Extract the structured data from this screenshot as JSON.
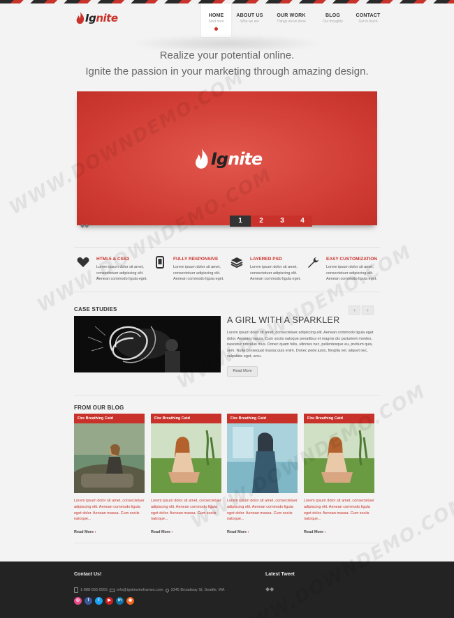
{
  "brand": {
    "logo_prefix": "Ig",
    "logo_suffix": "nite",
    "accent_color": "#c9322a",
    "dark_color": "#232323"
  },
  "nav": [
    {
      "label": "HOME",
      "sub": "Start here",
      "active": true
    },
    {
      "label": "ABOUT US",
      "sub": "Who we are"
    },
    {
      "label": "OUR WORK",
      "sub": "Things we've done"
    },
    {
      "label": "BLOG",
      "sub": "Our thoughts"
    },
    {
      "label": "CONTACT",
      "sub": "Get in touch"
    }
  ],
  "hero": {
    "tagline_1": "Realize your potential online.",
    "tagline_2": "Ignite the passion in your marketing through amazing design."
  },
  "slider": {
    "logo_prefix": "Ig",
    "logo_suffix": "nite",
    "pages": [
      "1",
      "2",
      "3",
      "4"
    ],
    "active_page": 1,
    "mini_nav_icon": "arrows-icon"
  },
  "features": [
    {
      "icon": "heart-icon",
      "title": "HTML5 & CSS3",
      "desc": "Lorem ipsum dolor sit amet, consectetuer adipiscing elit. Aenean commodo ligula eget."
    },
    {
      "icon": "mobile-icon",
      "title": "FULLY RESPONSIVE",
      "desc": "Lorem ipsum dolor sit amet, consectetuer adipiscing elit. Aenean commodo ligula eget."
    },
    {
      "icon": "layers-icon",
      "title": "LAYERED PSD",
      "desc": "Lorem ipsum dolor sit amet, consectetuer adipiscing elit. Aenean commodo ligula eget."
    },
    {
      "icon": "wrench-icon",
      "title": "EASY CUSTOMIZATION",
      "desc": "Lorem ipsum dolor sit amet, consectetuer adipiscing elit. Aenean commodo ligula eget."
    }
  ],
  "case_studies": {
    "section_title": "CASE STUDIES",
    "prev_icon": "‹",
    "next_icon": "›",
    "heading": "A GIRL WITH A SPARKLER",
    "text": "Lorem ipsum dolor sit amet, consectetuer adipiscing elit. Aenean commodo ligula eget dolor. Aenean massa. Cum sociis natoque penatibus et magnis dis parturient montes, nascetur ridiculus mus. Donec quam felis, ultricies nec, pellentesque eu, pretium quis, sem. Nulla consequat massa quis enim. Donec pede justo, fringilla vel, aliquet nec, vulputate eget, arcu.",
    "button": "Read More"
  },
  "blog": {
    "section_title": "FROM OUR BLOG",
    "posts": [
      {
        "header": "Fire Breathing Catd",
        "excerpt": "Lorem ipsum dolor sit amet, consectetuer adipiscing elit. Aenean commodo ligula eget dolor. Aenean massa. Cum sociis natoque...",
        "more": "Read More"
      },
      {
        "header": "Fire Breathing Catd",
        "excerpt": "Lorem ipsum dolor sit amet, consectetuer adipiscing elit. Aenean commodo ligula eget dolor. Aenean massa. Cum sociis natoque...",
        "more": "Read More"
      },
      {
        "header": "Fire Breathing Catd",
        "excerpt": "Lorem ipsum dolor sit amet, consectetuer adipiscing elit. Aenean commodo ligula eget dolor. Aenean massa. Cum sociis natoque...",
        "more": "Read More"
      },
      {
        "header": "Fire Breathing Catd",
        "excerpt": "Lorem ipsum dolor sit amet, consectetuer adipiscing elit. Aenean commodo ligula eget dolor. Aenean massa. Cum sociis natoque...",
        "more": "Read More"
      }
    ]
  },
  "footer": {
    "contact_title": "Contact Us!",
    "tweet_title": "Latest Tweet",
    "phone": "1-888-555-5555",
    "email": "info@ignitewireframes.com",
    "address": "2345 Broadway St, Seattle, WA",
    "tweet_nav_icon": "arrows-icon",
    "social": [
      {
        "icon": "dribbble-icon",
        "glyph": "◎",
        "color": "#ea4c89"
      },
      {
        "icon": "facebook-icon",
        "glyph": "f",
        "color": "#3b5998"
      },
      {
        "icon": "twitter-icon",
        "glyph": "t",
        "color": "#1da1f2"
      },
      {
        "icon": "youtube-icon",
        "glyph": "▶",
        "color": "#cc2222"
      },
      {
        "icon": "linkedin-icon",
        "glyph": "in",
        "color": "#0e76a8"
      },
      {
        "icon": "rss-icon",
        "glyph": "◉",
        "color": "#f26522"
      }
    ]
  },
  "watermark": "WWW.DOWNDEMO.COM"
}
